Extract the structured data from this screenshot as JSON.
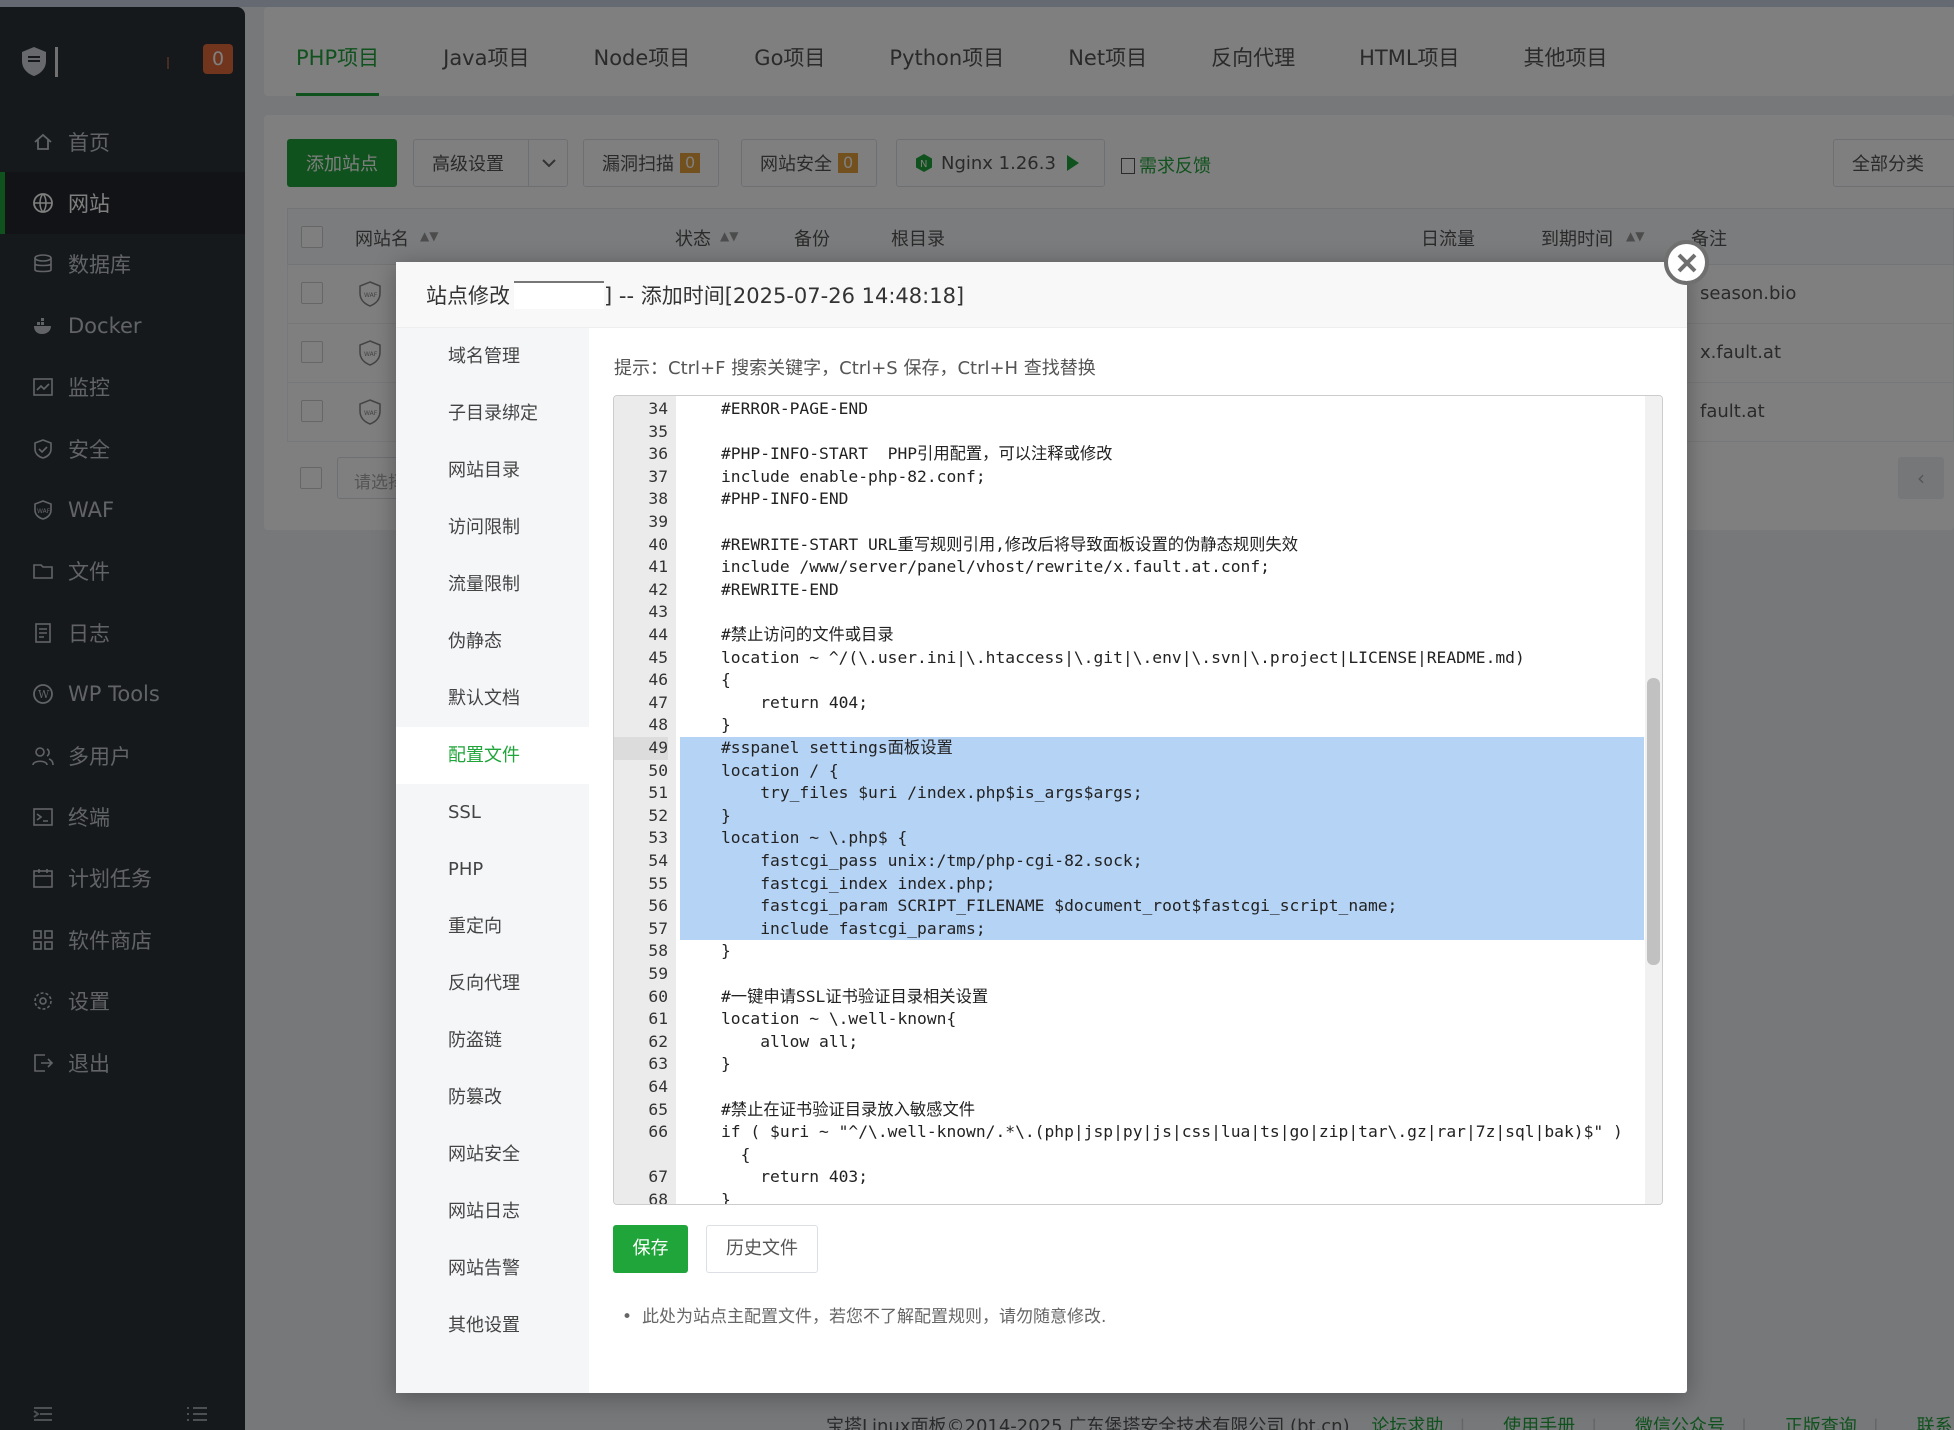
{
  "sidebar": {
    "badge": "0",
    "items": [
      {
        "label": "首页",
        "icon": "home-icon"
      },
      {
        "label": "网站",
        "icon": "globe-icon"
      },
      {
        "label": "数据库",
        "icon": "database-icon"
      },
      {
        "label": "Docker",
        "icon": "docker-icon"
      },
      {
        "label": "监控",
        "icon": "monitor-icon"
      },
      {
        "label": "安全",
        "icon": "shield-icon"
      },
      {
        "label": "WAF",
        "icon": "waf-icon"
      },
      {
        "label": "文件",
        "icon": "folder-icon"
      },
      {
        "label": "日志",
        "icon": "log-icon"
      },
      {
        "label": "WP Tools",
        "icon": "wordpress-icon"
      },
      {
        "label": "多用户",
        "icon": "users-icon"
      },
      {
        "label": "终端",
        "icon": "terminal-icon"
      },
      {
        "label": "计划任务",
        "icon": "calendar-icon"
      },
      {
        "label": "软件商店",
        "icon": "apps-icon"
      },
      {
        "label": "设置",
        "icon": "gear-icon"
      },
      {
        "label": "退出",
        "icon": "logout-icon"
      }
    ]
  },
  "tabs": [
    "PHP项目",
    "Java项目",
    "Node项目",
    "Go项目",
    "Python项目",
    "Net项目",
    "反向代理",
    "HTML项目",
    "其他项目"
  ],
  "toolbar": {
    "add_site": "添加站点",
    "advanced": "高级设置",
    "vuln_scan": "漏洞扫描",
    "vuln_count": "0",
    "site_security": "网站安全",
    "security_count": "0",
    "nginx": "Nginx 1.26.3",
    "feedback": "需求反馈",
    "category": "全部分类"
  },
  "table": {
    "headers": {
      "name": "网站名",
      "status": "状态",
      "backup": "备份",
      "root": "根目录",
      "traffic": "日流量",
      "expire": "到期时间",
      "remark": "备注"
    },
    "rows": [
      {
        "remark": "season.bio"
      },
      {
        "remark": "x.fault.at"
      },
      {
        "remark": "fault.at"
      }
    ],
    "search_placeholder": "请选择"
  },
  "footer": {
    "copyright": "宝塔Linux面板©2014-2025 广东堡塔安全技术有限公司 (bt.cn)",
    "forum": "论坛求助",
    "manual": "使用手册",
    "wechat": "微信公众号",
    "auth": "正版查询",
    "support": "联系人工客服"
  },
  "modal": {
    "title_prefix": "站点修改",
    "title_suffix": "] -- 添加时间[2025-07-26 14:48:18]",
    "nav": [
      "域名管理",
      "子目录绑定",
      "网站目录",
      "访问限制",
      "流量限制",
      "伪静态",
      "默认文档",
      "配置文件",
      "SSL",
      "PHP",
      "重定向",
      "反向代理",
      "防盗链",
      "防篡改",
      "网站安全",
      "网站日志",
      "网站告警",
      "其他设置"
    ],
    "active_nav": "配置文件",
    "hint": "提示：Ctrl+F 搜索关键字，Ctrl+S 保存，Ctrl+H 查找替换",
    "save": "保存",
    "history": "历史文件",
    "note": "此处为站点主配置文件，若您不了解配置规则，请勿随意修改."
  },
  "editor": {
    "lines": [
      {
        "n": "34",
        "t": "#ERROR-PAGE-END",
        "c": "cm"
      },
      {
        "n": "35",
        "t": ""
      },
      {
        "n": "36",
        "t": "#PHP-INFO-START  PHP引用配置，可以注释或修改",
        "c": "cm"
      },
      {
        "n": "37",
        "t": "include enable-php-82.conf;"
      },
      {
        "n": "38",
        "t": "#PHP-INFO-END",
        "c": "cm"
      },
      {
        "n": "39",
        "t": ""
      },
      {
        "n": "40",
        "t": "#REWRITE-START URL重写规则引用,修改后将导致面板设置的伪静态规则失效",
        "c": "cm"
      },
      {
        "n": "41",
        "t": "include /www/server/panel/vhost/rewrite/x.fault.at.conf;"
      },
      {
        "n": "42",
        "t": "#REWRITE-END",
        "c": "cm"
      },
      {
        "n": "43",
        "t": ""
      },
      {
        "n": "44",
        "t": "#禁止访问的文件或目录",
        "c": "cm"
      },
      {
        "n": "45",
        "t": "location ~ ^/(\\.user.ini|\\.htaccess|\\.git|\\.env|\\.svn|\\.project|LICENSE|README.md)"
      },
      {
        "n": "46",
        "t": "{"
      },
      {
        "n": "47",
        "t": "    return 404;"
      },
      {
        "n": "48",
        "t": "}"
      },
      {
        "n": "49",
        "t": "#sspanel settings面板设置",
        "c": "cm",
        "sel": true,
        "cur": true
      },
      {
        "n": "50",
        "t": "location / {",
        "sel": true
      },
      {
        "n": "51",
        "t": "    try_files $uri /index.php$is_args$args;",
        "sel": true
      },
      {
        "n": "52",
        "t": "}",
        "sel": true
      },
      {
        "n": "53",
        "t": "location ~ \\.php$ {",
        "sel": true
      },
      {
        "n": "54",
        "t": "    fastcgi_pass unix:/tmp/php-cgi-82.sock;",
        "sel": true
      },
      {
        "n": "55",
        "t": "    fastcgi_index index.php;",
        "sel": true
      },
      {
        "n": "56",
        "t": "    fastcgi_param SCRIPT_FILENAME $document_root$fastcgi_script_name;",
        "sel": true
      },
      {
        "n": "57",
        "t": "    include fastcgi_params;",
        "sel": true
      },
      {
        "n": "58",
        "t": "}"
      },
      {
        "n": "59",
        "t": ""
      },
      {
        "n": "60",
        "t": "#一键申请SSL证书验证目录相关设置",
        "c": "cm"
      },
      {
        "n": "61",
        "t": "location ~ \\.well-known{"
      },
      {
        "n": "62",
        "t": "    allow all;"
      },
      {
        "n": "63",
        "t": "}"
      },
      {
        "n": "64",
        "t": ""
      },
      {
        "n": "65",
        "t": "#禁止在证书验证目录放入敏感文件",
        "c": "cm"
      },
      {
        "n": "66",
        "t": "if ( $uri ~ \"^/\\.well-known/.*\\.(php|jsp|py|js|css|lua|ts|go|zip|tar\\.gz|rar|7z|sql|bak)$\" )"
      },
      {
        "n": "",
        "t": "  {"
      },
      {
        "n": "67",
        "t": "    return 403;"
      },
      {
        "n": "68",
        "t": "}"
      }
    ]
  }
}
